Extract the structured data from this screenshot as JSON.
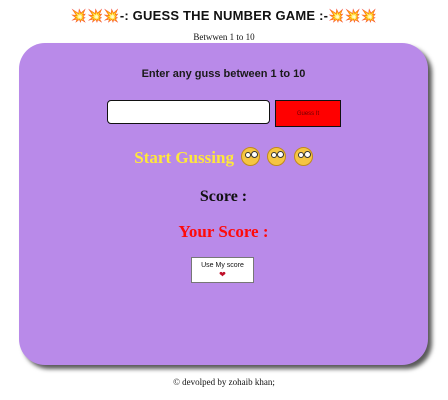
{
  "header": {
    "title": "💥💥💥-: GUESS THE NUMBER GAME :-💥💥💥",
    "subtitle": "Betwwen 1 to 10"
  },
  "game": {
    "prompt": "Enter any guss between 1 to 10",
    "input_value": "",
    "guess_button_label": "Guess It",
    "status_text": "Start Gussing",
    "status_icon": "dizzy-face-icon",
    "score_label": "Score :",
    "your_score_label": "Your Score :",
    "use_score_button_label": "Use My score",
    "heart_icon": "heart-icon"
  },
  "footer": {
    "text": "© devolped by zohaib khan;"
  },
  "colors": {
    "card_bg": "#b98ae9",
    "status_text": "#ffe83a",
    "your_score_text": "#ff0a0a",
    "guess_button_bg": "#ff0000"
  }
}
